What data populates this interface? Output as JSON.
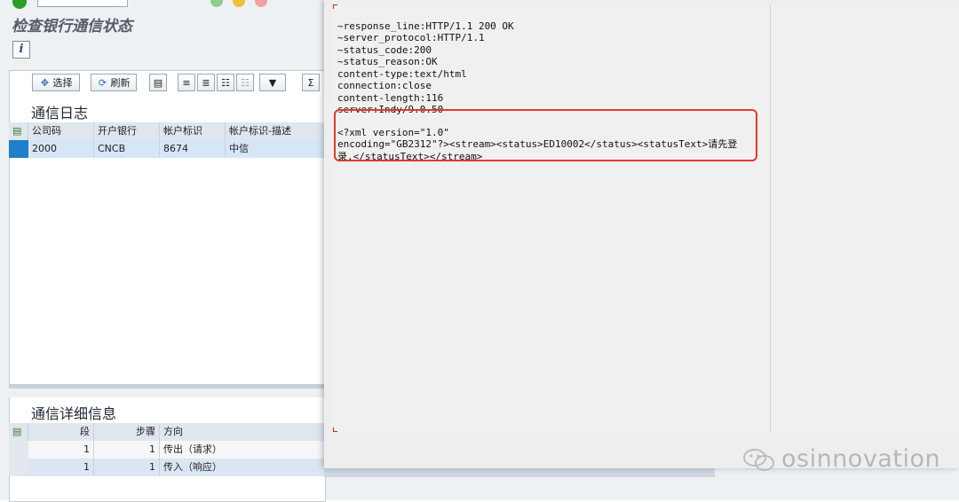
{
  "app": {
    "title": "检查银行通信状态",
    "info_icon": "i"
  },
  "toolbar": {
    "select_label": "选择",
    "refresh_label": "刷新",
    "sum_label": "Σ"
  },
  "comm_log": {
    "title": "通信日志",
    "columns": [
      "公司码",
      "开户银行",
      "帐户标识",
      "帐户标识-描述"
    ],
    "rows": [
      [
        "2000",
        "CNCB",
        "8674",
        "中信"
      ]
    ]
  },
  "comm_detail": {
    "title": "通信详细信息",
    "columns": [
      "段",
      "步骤",
      "方向"
    ],
    "rows": [
      [
        "1",
        "1",
        "传出（请求）"
      ],
      [
        "1",
        "1",
        "传入（响应）"
      ]
    ]
  },
  "response": {
    "header_lines": [
      "~response_line:HTTP/1.1 200 OK",
      "~server_protocol:HTTP/1.1",
      "~status_code:200",
      "~status_reason:OK",
      "content-type:text/html",
      "connection:close",
      "content-length:116",
      "server:Indy/9.0.50"
    ],
    "body_lines": [
      "<?xml version=\"1.0\"",
      "encoding=\"GB2312\"?><stream><status>ED10002</status><statusText>请先登",
      "录.</statusText></stream>"
    ]
  },
  "watermark": {
    "text": "osinnovation"
  },
  "colors": {
    "highlight": "#e03a2e",
    "selected_row": "#d6e6f6",
    "header_row": "#dfe6ee"
  }
}
